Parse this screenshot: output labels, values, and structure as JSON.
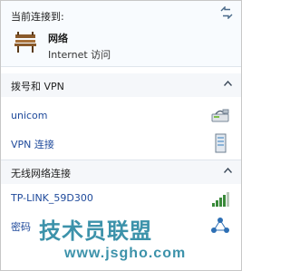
{
  "current": {
    "header": "当前连接到:",
    "network_name": "网络",
    "network_status": "Internet 访问"
  },
  "sections": [
    {
      "title": "拨号和 VPN",
      "items": [
        {
          "name": "unicom",
          "icon": "dialup-modem-icon"
        },
        {
          "name": "VPN 连接",
          "icon": "vpn-server-icon"
        }
      ]
    },
    {
      "title": "无线网络连接",
      "items": [
        {
          "name": "TP-LINK_59D300",
          "icon": "wifi-signal-icon"
        },
        {
          "name": "密码",
          "icon": "network-share-icon"
        }
      ]
    }
  ],
  "watermark": {
    "text": "技术员联盟",
    "url": "www.jsgho.com"
  },
  "colors": {
    "link": "#1f4a9b",
    "section_bg": "#f5f7fa",
    "watermark": "#1b7f9c"
  }
}
